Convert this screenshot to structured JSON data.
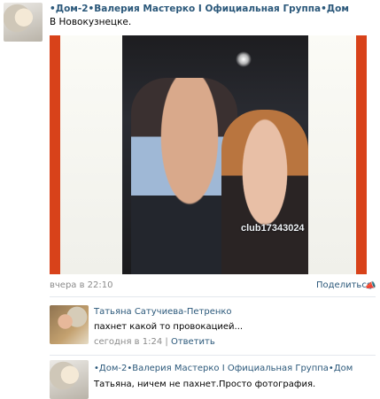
{
  "post": {
    "author": "•Дом-2•Валерия Мастерко I Официальная Группа•Дом",
    "text": "В Новокузнецке.",
    "photo_watermark": "club17343024",
    "date": "вчера в 22:10",
    "share_label": "Поделиться",
    "share_icon": "megaphone-icon"
  },
  "comments": [
    {
      "author": "Татьяна Сатучиева-Петренко",
      "text": "пахнет какой то провокацией...",
      "date": "сегодня в 1:24",
      "separator": "|",
      "reply_label": "Ответить"
    },
    {
      "author": "•Дом-2•Валерия Мастерко I Официальная Группа•Дом",
      "text": "Татьяна, ничем не пахнет.Просто фотография."
    }
  ],
  "colors": {
    "link": "#2b587a",
    "meta": "#8a8a8a",
    "photo_border": "#d8421a"
  }
}
